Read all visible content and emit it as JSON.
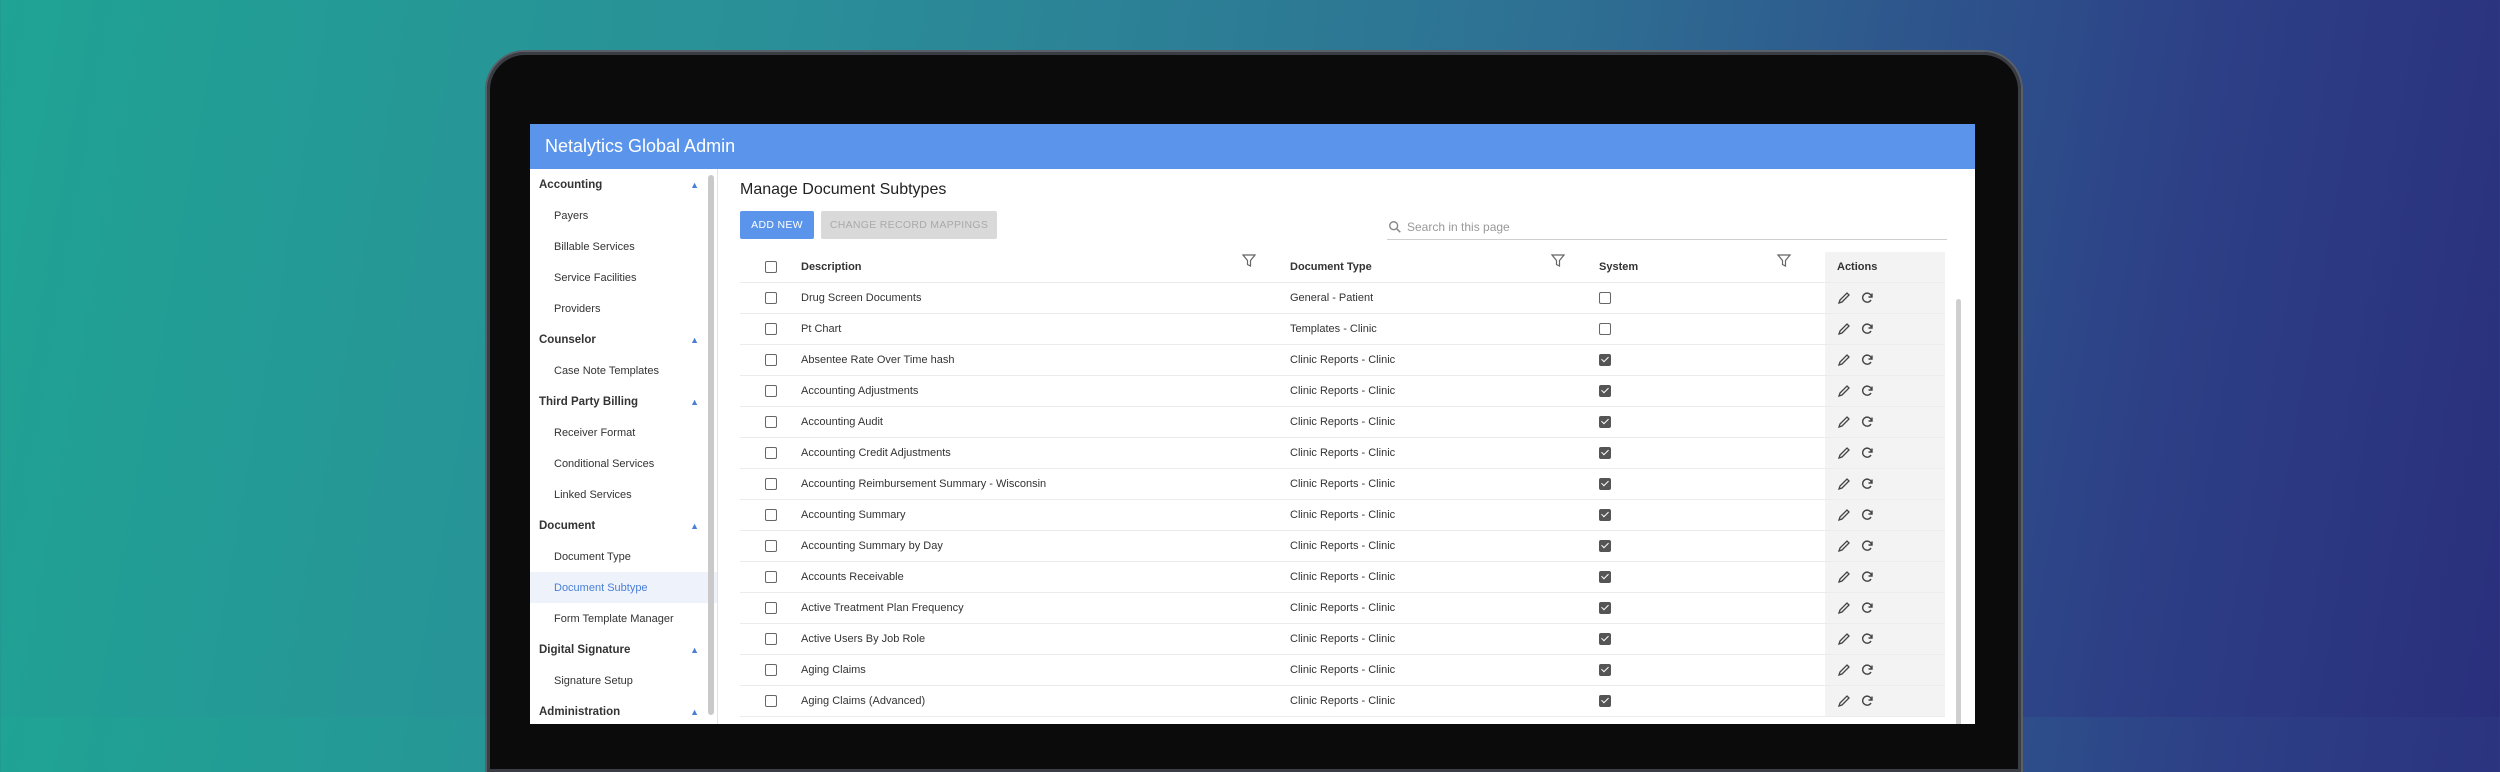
{
  "app": {
    "title": "Netalytics Global Admin"
  },
  "sidebar": {
    "groups": [
      {
        "label": "Accounting",
        "items": [
          {
            "label": "Payers"
          },
          {
            "label": "Billable Services"
          },
          {
            "label": "Service Facilities"
          },
          {
            "label": "Providers"
          }
        ]
      },
      {
        "label": "Counselor",
        "items": [
          {
            "label": "Case Note Templates"
          }
        ]
      },
      {
        "label": "Third Party Billing",
        "items": [
          {
            "label": "Receiver Format"
          },
          {
            "label": "Conditional Services"
          },
          {
            "label": "Linked Services"
          }
        ]
      },
      {
        "label": "Document",
        "items": [
          {
            "label": "Document Type"
          },
          {
            "label": "Document Subtype"
          },
          {
            "label": "Form Template Manager"
          }
        ]
      },
      {
        "label": "Digital Signature",
        "items": [
          {
            "label": "Signature Setup"
          }
        ]
      },
      {
        "label": "Administration",
        "items": []
      }
    ],
    "active_item": "Document Subtype"
  },
  "page": {
    "title": "Manage Document Subtypes",
    "add_new_label": "ADD NEW",
    "change_mappings_label": "CHANGE RECORD MAPPINGS",
    "search_placeholder": "Search in this page"
  },
  "table": {
    "headers": {
      "description": "Description",
      "document_type": "Document Type",
      "system": "System",
      "actions": "Actions"
    },
    "rows": [
      {
        "description": "Drug Screen Documents",
        "document_type": "General - Patient",
        "system": false
      },
      {
        "description": "Pt Chart",
        "document_type": "Templates - Clinic",
        "system": false
      },
      {
        "description": "Absentee Rate Over Time hash",
        "document_type": "Clinic Reports - Clinic",
        "system": true
      },
      {
        "description": "Accounting Adjustments",
        "document_type": "Clinic Reports - Clinic",
        "system": true
      },
      {
        "description": "Accounting Audit",
        "document_type": "Clinic Reports - Clinic",
        "system": true
      },
      {
        "description": "Accounting Credit Adjustments",
        "document_type": "Clinic Reports - Clinic",
        "system": true
      },
      {
        "description": "Accounting Reimbursement Summary - Wisconsin",
        "document_type": "Clinic Reports - Clinic",
        "system": true
      },
      {
        "description": "Accounting Summary",
        "document_type": "Clinic Reports - Clinic",
        "system": true
      },
      {
        "description": "Accounting Summary by Day",
        "document_type": "Clinic Reports - Clinic",
        "system": true
      },
      {
        "description": "Accounts Receivable",
        "document_type": "Clinic Reports - Clinic",
        "system": true
      },
      {
        "description": "Active Treatment Plan Frequency",
        "document_type": "Clinic Reports - Clinic",
        "system": true
      },
      {
        "description": "Active Users By Job Role",
        "document_type": "Clinic Reports - Clinic",
        "system": true
      },
      {
        "description": "Aging Claims",
        "document_type": "Clinic Reports - Clinic",
        "system": true
      },
      {
        "description": "Aging Claims (Advanced)",
        "document_type": "Clinic Reports - Clinic",
        "system": true
      }
    ],
    "action_icons": [
      "pencil-icon",
      "refresh-icon"
    ]
  },
  "colors": {
    "appbar": "#5b95eb",
    "accent": "#4a7fd6"
  }
}
